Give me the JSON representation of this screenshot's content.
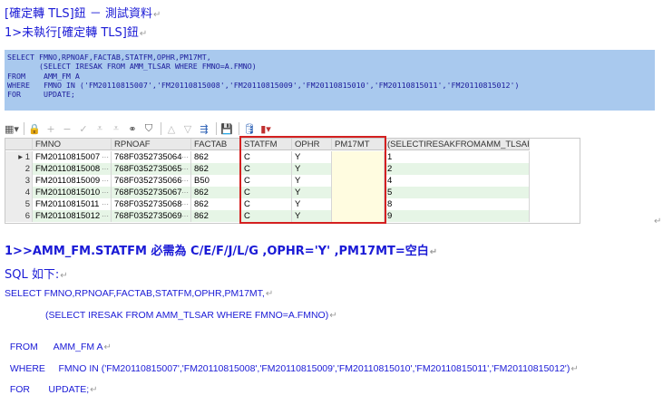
{
  "doc": {
    "title": "[確定轉 TLS]鈕 － 測試資料",
    "subtitle": "1>未執行[確定轉 TLS]鈕",
    "pilcrow": "↵"
  },
  "sql_box": {
    "lines": [
      "SELECT FMNO,RPNOAF,FACTAB,STATFM,OPHR,PM17MT,",
      "       (SELECT IRESAK FROM AMM_TLSAR WHERE FMNO=A.FMNO)",
      "FROM    AMM_FM A",
      "WHERE   FMNO IN ('FM20110815007','FM20110815008','FM20110815009','FM20110815010','FM20110815011','FM20110815012')",
      "FOR     UPDATE;"
    ]
  },
  "toolbar": {
    "icons": [
      "grid-icon",
      "lock-icon",
      "plus-icon",
      "minus-icon",
      "check-icon",
      "first-icon",
      "down-icon",
      "binoculars-icon",
      "funnel-icon",
      "triangle-up-icon",
      "triangle-down-icon",
      "link-icon",
      "save-icon",
      "database-icon",
      "chart-icon"
    ]
  },
  "grid": {
    "columns": [
      "FMNO",
      "RPNOAF",
      "FACTAB",
      "STATFM",
      "OPHR",
      "PM17MT",
      "(SELECTIRESAKFROMAMM_TLSARWHER"
    ],
    "rows": [
      {
        "num": "1",
        "fmno": "FM20110815007",
        "rpnoaf": "768F0352735064",
        "factab": "862",
        "statfm": "C",
        "ophr": "Y",
        "pm17mt": "",
        "sel": "1"
      },
      {
        "num": "2",
        "fmno": "FM20110815008",
        "rpnoaf": "768F0352735065",
        "factab": "862",
        "statfm": "C",
        "ophr": "Y",
        "pm17mt": "",
        "sel": "2"
      },
      {
        "num": "3",
        "fmno": "FM20110815009",
        "rpnoaf": "768F0352735066",
        "factab": "B50",
        "statfm": "C",
        "ophr": "Y",
        "pm17mt": "",
        "sel": "4"
      },
      {
        "num": "4",
        "fmno": "FM20110815010",
        "rpnoaf": "768F0352735067",
        "factab": "862",
        "statfm": "C",
        "ophr": "Y",
        "pm17mt": "",
        "sel": "5"
      },
      {
        "num": "5",
        "fmno": "FM20110815011",
        "rpnoaf": "768F0352735068",
        "factab": "862",
        "statfm": "C",
        "ophr": "Y",
        "pm17mt": "",
        "sel": "8"
      },
      {
        "num": "6",
        "fmno": "FM20110815012",
        "rpnoaf": "768F0352735069",
        "factab": "862",
        "statfm": "C",
        "ophr": "Y",
        "pm17mt": "",
        "sel": "9"
      }
    ],
    "row_colors": [
      "#ffffff",
      "#e6f5e6"
    ]
  },
  "section": {
    "heading": "1>>AMM_FM.STATFM 必需為 C/E/F/J/L/G ,OPHR='Y' ,PM17MT=空白",
    "sql_label": "SQL 如下:",
    "sql_lines": [
      "SELECT FMNO,RPNOAF,FACTAB,STATFM,OPHR,PM17MT,",
      "(SELECT IRESAK FROM AMM_TLSAR WHERE FMNO=A.FMNO)",
      "FROM      AMM_FM A",
      "WHERE     FMNO IN ('FM20110815007','FM20110815008','FM20110815009','FM20110815010','FM20110815011','FM20110815012')",
      "FOR       UPDATE;"
    ]
  },
  "colors": {
    "accent": "#1a1ad6",
    "highlight": "#a9c9ee",
    "redbox": "#d42020",
    "alt_row": "#e6f5e6"
  }
}
